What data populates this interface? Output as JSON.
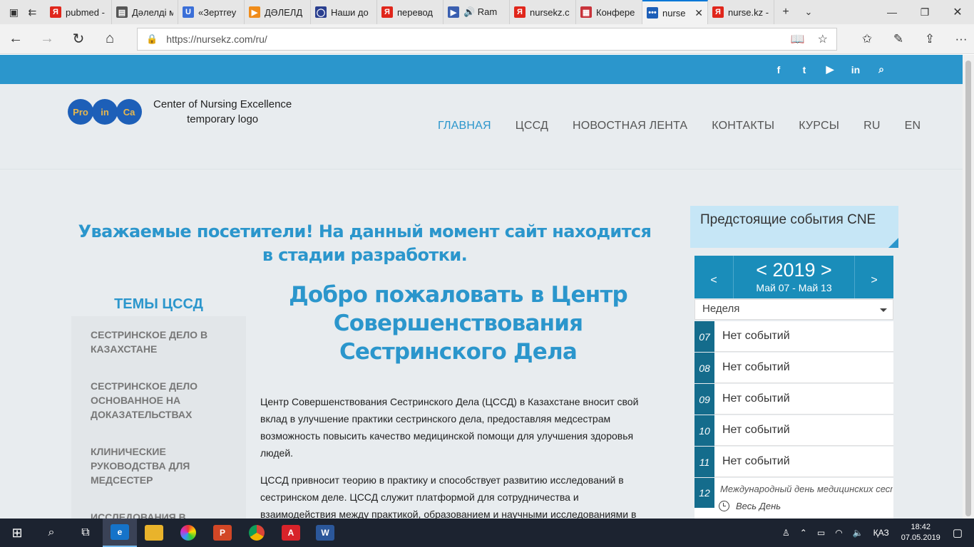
{
  "browser": {
    "tabs": [
      {
        "label": "pubmed -",
        "fav": "Я",
        "color": "#e0261b"
      },
      {
        "label": "Дәлелді м",
        "fav": "▤",
        "color": "#555555"
      },
      {
        "label": "«Зертгеу",
        "fav": "U",
        "color": "#3b6fd8"
      },
      {
        "label": "ДӘЛЕЛД",
        "fav": "▶",
        "color": "#f08c1a"
      },
      {
        "label": "Наши до",
        "fav": "◯",
        "color": "#2a3f8f"
      },
      {
        "label": "перевод",
        "fav": "Я",
        "color": "#e0261b"
      },
      {
        "label": "🔊 Ram",
        "fav": "▶",
        "color": "#3a5fb0"
      },
      {
        "label": "nursekz.c",
        "fav": "Я",
        "color": "#e0261b"
      },
      {
        "label": "Конфере",
        "fav": "▦",
        "color": "#c8333a"
      },
      {
        "label": "nurse",
        "fav": "•••",
        "color": "#1d5fb8"
      },
      {
        "label": "nurse.kz -",
        "fav": "Я",
        "color": "#e0261b"
      }
    ],
    "url": "https://nursekz.com/ru/"
  },
  "site": {
    "logo": {
      "c1": "Pro",
      "c2": "in",
      "c3": "Ca",
      "line1": "Center of Nursing Excellence",
      "line2": "temporary logo"
    },
    "menu": [
      "ГЛАВНАЯ",
      "ЦССД",
      "НОВОСТНАЯ ЛЕНТА",
      "КОНТАКТЫ",
      "КУРСЫ",
      "RU",
      "EN"
    ],
    "notice": "Уважаемые посетители! На данный момент сайт находится в стадии разработки.",
    "welcome": "Добро пожаловать в Центр Совершенствования Сестринского Дела",
    "topics_title": "ТЕМЫ ЦССД",
    "topics": [
      "СЕСТРИНСКОЕ ДЕЛО В КАЗАХСТАНЕ",
      "СЕСТРИНСКОЕ ДЕЛО ОСНОВАННОЕ НА ДОКАЗАТЕЛЬСТВАХ",
      "КЛИНИЧЕСКИЕ РУКОВОДСТВА ДЛЯ МЕДСЕСТЕР",
      "ИССЛЕДОВАНИЯ В"
    ],
    "para1": "Центр Совершенствования Сестринского Дела (ЦССД) в Казахстане вносит свой вклад в улучшение практики сестринского дела, предоставляя медсестрам возможность повысить качество медицинской помощи для улучшения здоровья людей.",
    "para2": "ЦССД привносит теорию в практику и способствует развитию исследований в сестринском деле. ЦССД служит платформой для сотрудничества и взаимодействия между практикой, образованием и научными исследованиями в",
    "events": {
      "title": "Предстоящие события CNE",
      "prev": "<",
      "next": ">",
      "year": "< 2019 >",
      "range": "Май 07 - Май 13",
      "view": "Неделя",
      "days": [
        {
          "num": "07",
          "text": "Нет событий"
        },
        {
          "num": "08",
          "text": "Нет событий"
        },
        {
          "num": "09",
          "text": "Нет событий"
        },
        {
          "num": "10",
          "text": "Нет событий"
        },
        {
          "num": "11",
          "text": "Нет событий"
        }
      ],
      "day12": {
        "num": "12",
        "event": "Международный день медицинских сестер",
        "allday": "Весь День"
      }
    }
  },
  "taskbar": {
    "lang": "ҚАЗ",
    "time": "18:42",
    "date": "07.05.2019"
  }
}
